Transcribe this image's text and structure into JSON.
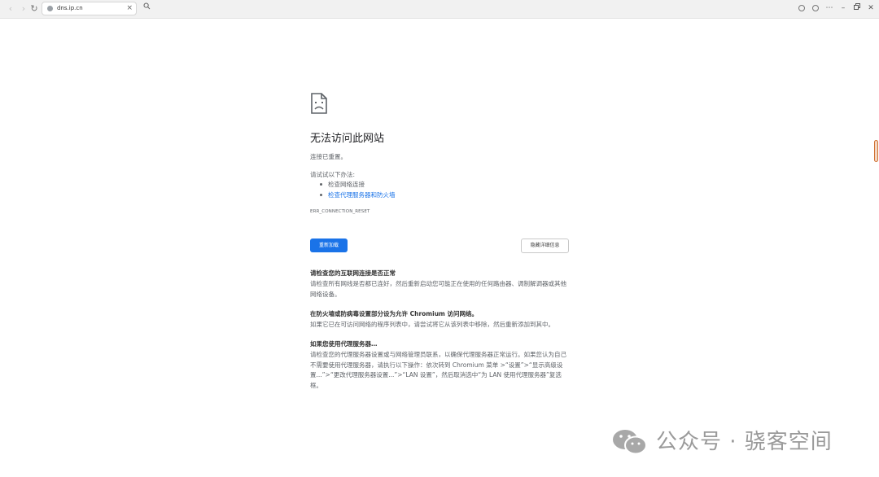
{
  "browser": {
    "tab_title": "dns.ip.cn",
    "tab_close": "×"
  },
  "error_page": {
    "title": "无法访问此网站",
    "subtitle": "连接已重置。",
    "try_intro": "请试试以下办法:",
    "suggestions": [
      "检查网络连接",
      "检查代理服务器和防火墙"
    ],
    "error_code": "ERR_CONNECTION_RESET",
    "reload_button": "重新加载",
    "details_button": "隐藏详细信息",
    "sections": [
      {
        "heading": "请检查您的互联网连接是否正常",
        "body": "请检查所有网线是否都已连好，然后重新启动您可能正在使用的任何路由器、调制解调器或其他网络设备。"
      },
      {
        "heading": "在防火墙或防病毒设置部分设为允许 Chromium 访问网络。",
        "body": "如果它已在可访问网络的程序列表中，请尝试将它从该列表中移除，然后重新添加到其中。"
      },
      {
        "heading": "如果您使用代理服务器…",
        "body": "请检查您的代理服务器设置或与网络管理员联系，以确保代理服务器正常运行。如果您认为自己不需要使用代理服务器，请执行以下操作：依次转到 Chromium 菜单 >“设置”>“显示高级设置...”>“更改代理服务器设置...”>“LAN 设置”，然后取消选中“为 LAN 使用代理服务器”复选框。"
      }
    ]
  },
  "watermark": {
    "text": "公众号 · 骁客空间"
  },
  "colors": {
    "primary": "#1a73e8",
    "link": "#1a73e8",
    "topbar": "#f1f1f1"
  }
}
